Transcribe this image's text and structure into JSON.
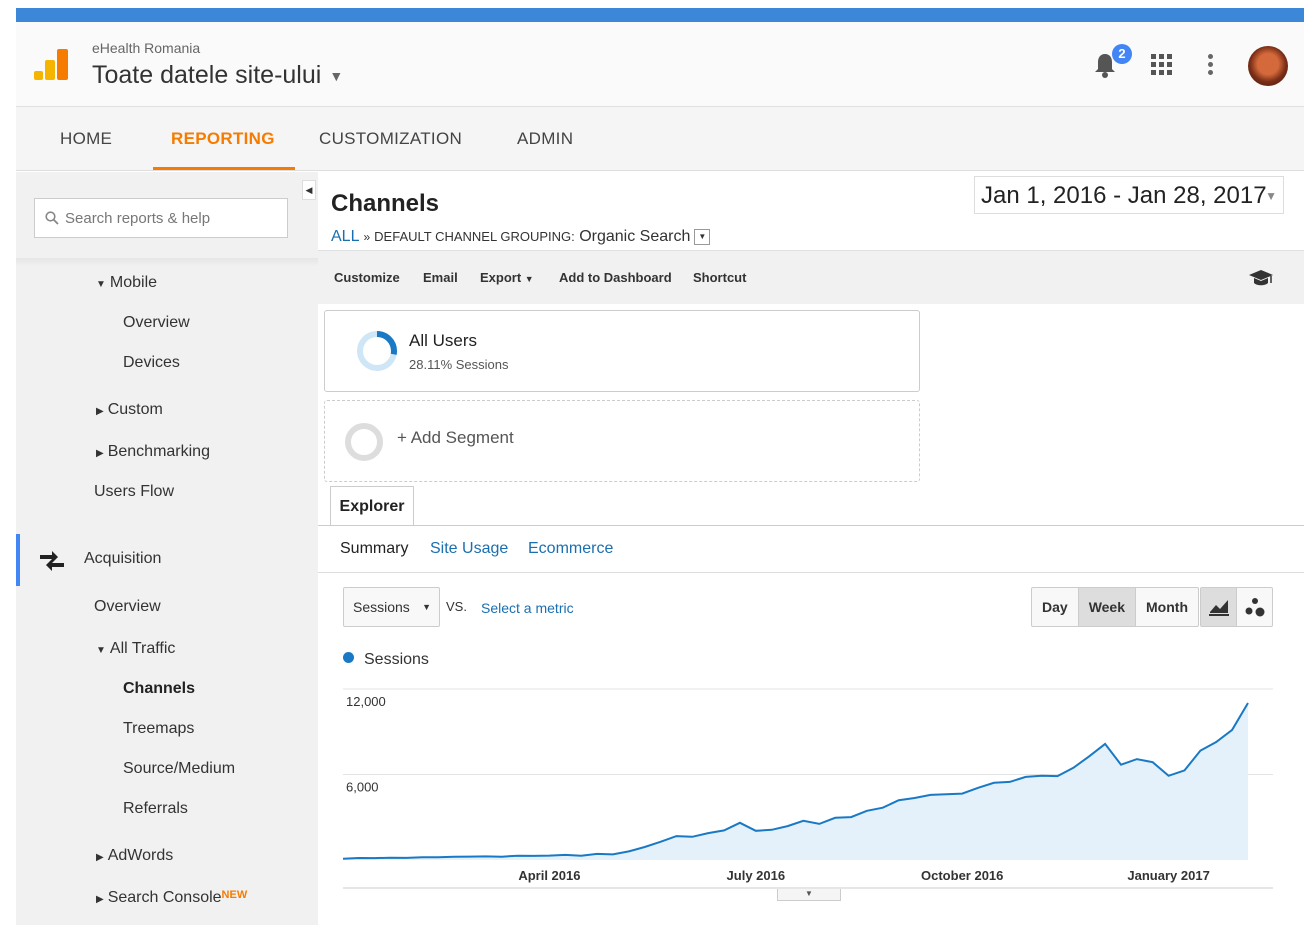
{
  "header": {
    "account": "eHealth Romania",
    "property": "Toate datele site-ului",
    "notifications_count": "2"
  },
  "nav": {
    "tabs": [
      {
        "label": "HOME"
      },
      {
        "label": "REPORTING",
        "active": true
      },
      {
        "label": "CUSTOMIZATION"
      },
      {
        "label": "ADMIN"
      }
    ]
  },
  "sidebar": {
    "search_placeholder": "Search reports & help",
    "items": {
      "mobile": "Mobile",
      "mobile_overview": "Overview",
      "devices": "Devices",
      "custom": "Custom",
      "benchmarking": "Benchmarking",
      "users_flow": "Users Flow",
      "acquisition": "Acquisition",
      "acq_overview": "Overview",
      "all_traffic": "All Traffic",
      "channels": "Channels",
      "treemaps": "Treemaps",
      "source_medium": "Source/Medium",
      "referrals": "Referrals",
      "adwords": "AdWords",
      "search_console": "Search Console",
      "new_tag": "NEW"
    }
  },
  "report": {
    "title": "Channels",
    "crumb_all": "ALL",
    "crumb_sep": "»",
    "crumb_grouping": "DEFAULT CHANNEL GROUPING:",
    "crumb_value": "Organic Search",
    "date_range": "Jan 1, 2016 - Jan 28, 2017"
  },
  "toolbar": {
    "customize": "Customize",
    "email": "Email",
    "export": "Export",
    "add_to_dashboard": "Add to Dashboard",
    "shortcut": "Shortcut"
  },
  "segments": {
    "seg1_name": "All Users",
    "seg1_sub": "28.11% Sessions",
    "seg1_fraction": 0.2811,
    "add": "+ Add Segment"
  },
  "explorer": {
    "tab": "Explorer",
    "subtabs": {
      "summary": "Summary",
      "site_usage": "Site Usage",
      "ecommerce": "Ecommerce"
    },
    "metric": "Sessions",
    "vs": "VS.",
    "select_metric": "Select a metric",
    "periods": {
      "day": "Day",
      "week": "Week",
      "month": "Month"
    },
    "legend": "Sessions"
  },
  "colors": {
    "accent_orange": "#f57c00",
    "line_blue": "#1a79c4",
    "area_fill": "#e5f1fa",
    "link_blue": "#1a6fb0"
  },
  "chart_data": {
    "type": "area",
    "series": [
      {
        "name": "Sessions",
        "values": [
          90,
          140,
          130,
          160,
          150,
          200,
          190,
          230,
          240,
          250,
          230,
          300,
          290,
          310,
          360,
          300,
          430,
          390,
          600,
          910,
          1280,
          1680,
          1630,
          1890,
          2080,
          2610,
          2050,
          2120,
          2380,
          2750,
          2530,
          2960,
          3010,
          3450,
          3670,
          4200,
          4350,
          4570,
          4620,
          4660,
          5070,
          5420,
          5480,
          5830,
          5910,
          5890,
          6470,
          7280,
          8150,
          6690,
          7080,
          6860,
          5910,
          6290,
          7680,
          8280,
          9130,
          11020
        ]
      }
    ],
    "x_tick_labels": [
      "April 2016",
      "July 2016",
      "October 2016",
      "January 2017"
    ],
    "y_tick_labels": [
      "12,000",
      "6,000"
    ],
    "ylim": [
      0,
      12000
    ],
    "grid": true
  }
}
